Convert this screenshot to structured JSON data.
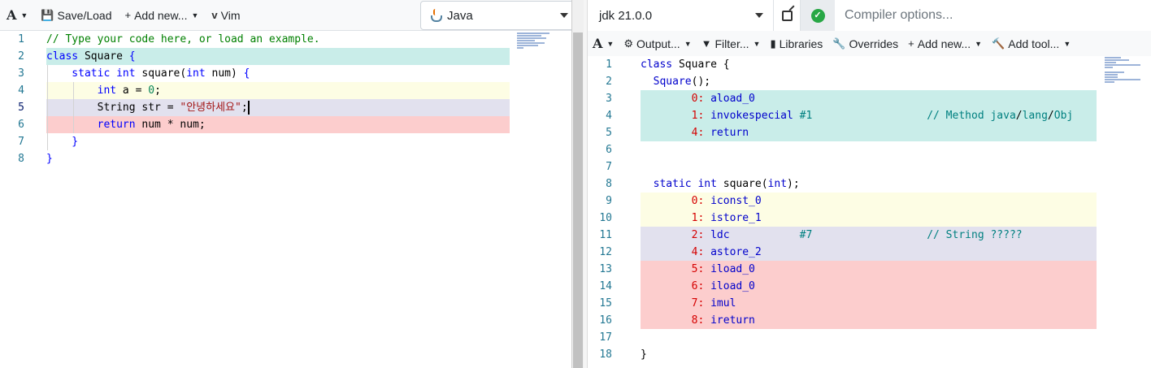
{
  "left_toolbar": {
    "font_button": "A",
    "save_load": "Save/Load",
    "add_new": "Add new...",
    "vim": "Vim",
    "language": "Java"
  },
  "source_lines": [
    {
      "n": "1",
      "parts": [
        {
          "c": "cmt",
          "t": "// Type your code here, or load an example."
        }
      ]
    },
    {
      "n": "2",
      "parts": [
        {
          "c": "kw",
          "t": "class "
        },
        {
          "c": "plain",
          "t": "Square "
        },
        {
          "c": "kw",
          "t": "{"
        }
      ]
    },
    {
      "n": "3",
      "parts": [
        {
          "c": "kw",
          "t": "    static int "
        },
        {
          "c": "plain",
          "t": "square("
        },
        {
          "c": "kw",
          "t": "int "
        },
        {
          "c": "plain",
          "t": "num) "
        },
        {
          "c": "kw",
          "t": "{"
        }
      ]
    },
    {
      "n": "4",
      "parts": [
        {
          "c": "kw",
          "t": "        int "
        },
        {
          "c": "plain",
          "t": "a = "
        },
        {
          "c": "num",
          "t": "0"
        },
        {
          "c": "plain",
          "t": ";"
        }
      ]
    },
    {
      "n": "5",
      "parts": [
        {
          "c": "plain",
          "t": "        String str = "
        },
        {
          "c": "str",
          "t": "\"안녕하세요\""
        },
        {
          "c": "plain",
          "t": ";"
        }
      ]
    },
    {
      "n": "6",
      "parts": [
        {
          "c": "kw",
          "t": "        return "
        },
        {
          "c": "plain",
          "t": "num * num;"
        }
      ]
    },
    {
      "n": "7",
      "parts": [
        {
          "c": "kw",
          "t": "    }"
        }
      ]
    },
    {
      "n": "8",
      "parts": [
        {
          "c": "kw",
          "t": "}"
        }
      ]
    }
  ],
  "compiler": {
    "name": "jdk 21.0.0",
    "options_placeholder": "Compiler options..."
  },
  "output_toolbar": {
    "font_button": "A",
    "output": "Output...",
    "filter": "Filter...",
    "libraries": "Libraries",
    "overrides": "Overrides",
    "add_new": "Add new...",
    "add_tool": "Add tool..."
  },
  "asm_lines": [
    {
      "n": "1",
      "parts": [
        {
          "c": "op",
          "t": "class "
        },
        {
          "c": "nm",
          "t": "Square {"
        }
      ]
    },
    {
      "n": "2",
      "parts": [
        {
          "c": "nm",
          "t": "  "
        },
        {
          "c": "op",
          "t": "Square"
        },
        {
          "c": "nm",
          "t": "();"
        }
      ]
    },
    {
      "n": "3",
      "parts": [
        {
          "c": "lbl",
          "t": "        0: "
        },
        {
          "c": "op",
          "t": "aload_0"
        }
      ]
    },
    {
      "n": "4",
      "parts": [
        {
          "c": "lbl",
          "t": "        1: "
        },
        {
          "c": "op",
          "t": "invokespecial "
        },
        {
          "c": "cm",
          "t": "#1                  // Method java"
        },
        {
          "c": "nm",
          "t": "/"
        },
        {
          "c": "cm",
          "t": "lang"
        },
        {
          "c": "nm",
          "t": "/"
        },
        {
          "c": "cm",
          "t": "Obj"
        }
      ]
    },
    {
      "n": "5",
      "parts": [
        {
          "c": "lbl",
          "t": "        4: "
        },
        {
          "c": "op",
          "t": "return"
        }
      ]
    },
    {
      "n": "6",
      "parts": []
    },
    {
      "n": "7",
      "parts": []
    },
    {
      "n": "8",
      "parts": [
        {
          "c": "nm",
          "t": "  "
        },
        {
          "c": "op",
          "t": "static int "
        },
        {
          "c": "nm",
          "t": "square("
        },
        {
          "c": "op",
          "t": "int"
        },
        {
          "c": "nm",
          "t": ");"
        }
      ]
    },
    {
      "n": "9",
      "parts": [
        {
          "c": "lbl",
          "t": "        0: "
        },
        {
          "c": "op",
          "t": "iconst_0"
        }
      ]
    },
    {
      "n": "10",
      "parts": [
        {
          "c": "lbl",
          "t": "        1: "
        },
        {
          "c": "op",
          "t": "istore_1"
        }
      ]
    },
    {
      "n": "11",
      "parts": [
        {
          "c": "lbl",
          "t": "        2: "
        },
        {
          "c": "op",
          "t": "ldc           "
        },
        {
          "c": "cm",
          "t": "#7                  // String ?????"
        }
      ]
    },
    {
      "n": "12",
      "parts": [
        {
          "c": "lbl",
          "t": "        4: "
        },
        {
          "c": "op",
          "t": "astore_2"
        }
      ]
    },
    {
      "n": "13",
      "parts": [
        {
          "c": "lbl",
          "t": "        5: "
        },
        {
          "c": "op",
          "t": "iload_0"
        }
      ]
    },
    {
      "n": "14",
      "parts": [
        {
          "c": "lbl",
          "t": "        6: "
        },
        {
          "c": "op",
          "t": "iload_0"
        }
      ]
    },
    {
      "n": "15",
      "parts": [
        {
          "c": "lbl",
          "t": "        7: "
        },
        {
          "c": "op",
          "t": "imul"
        }
      ]
    },
    {
      "n": "16",
      "parts": [
        {
          "c": "lbl",
          "t": "        8: "
        },
        {
          "c": "op",
          "t": "ireturn"
        }
      ]
    },
    {
      "n": "17",
      "parts": []
    },
    {
      "n": "18",
      "parts": [
        {
          "c": "nm",
          "t": "}"
        }
      ]
    }
  ],
  "colors": {
    "teal": "#c9ede9",
    "yellow": "#fdfde4",
    "lavender": "#e2e1ee",
    "red": "#fccdcd"
  }
}
